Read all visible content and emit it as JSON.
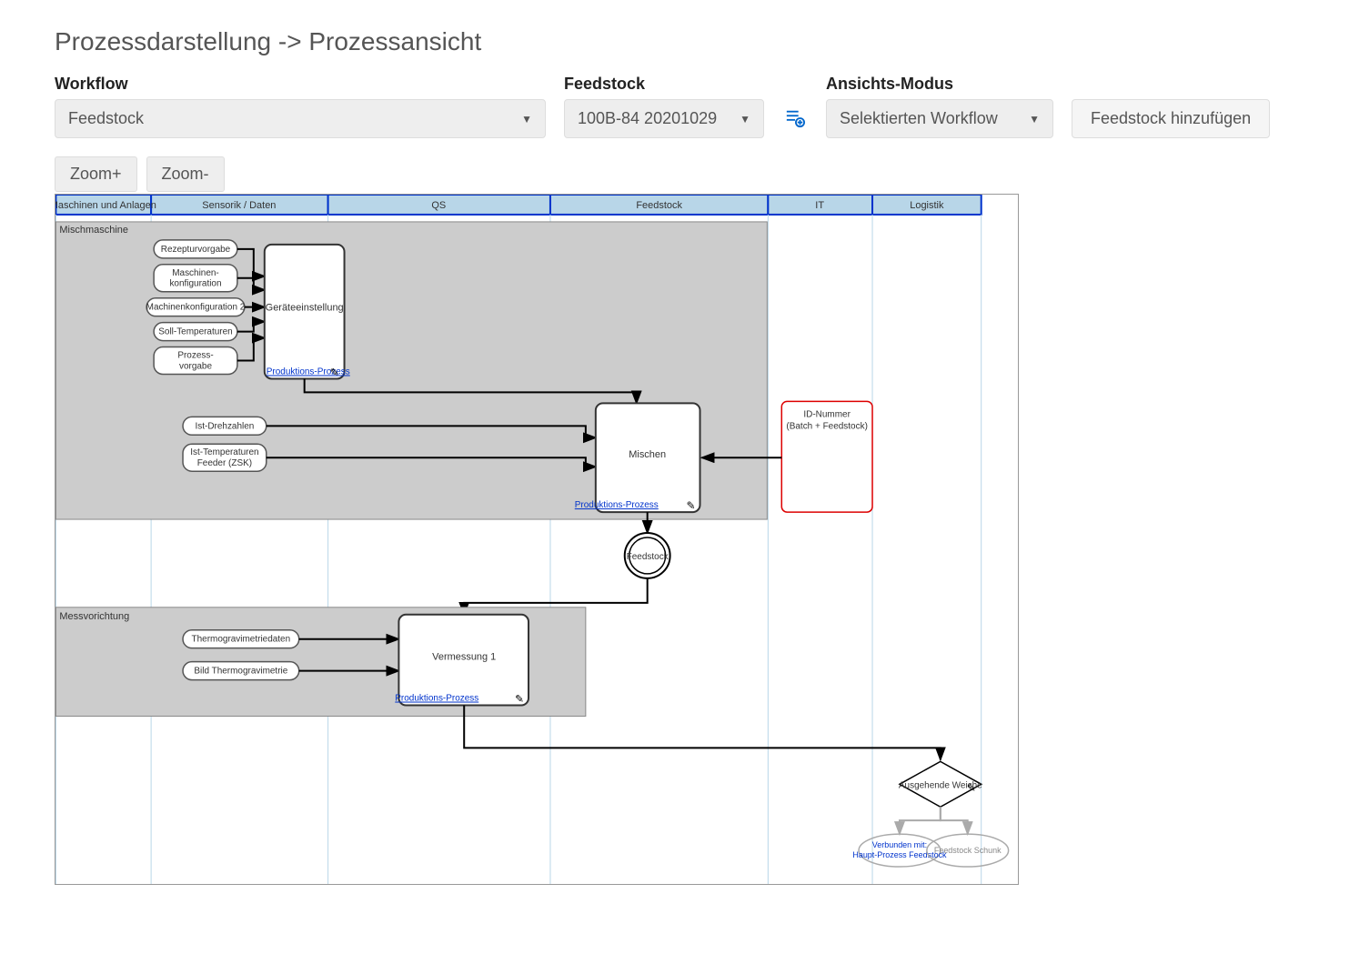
{
  "page_title": "Prozessdarstellung -> Prozessansicht",
  "controls": {
    "workflow_label": "Workflow",
    "workflow_value": "Feedstock",
    "feedstock_label": "Feedstock",
    "feedstock_value": "100B-84 20201029",
    "viewmode_label": "Ansichts-Modus",
    "viewmode_value": "Selektierten Workflow",
    "add_feedstock_label": "Feedstock hinzufügen"
  },
  "zoom": {
    "in": "Zoom+",
    "out": "Zoom-"
  },
  "lanes": {
    "l1": "Maschinen und Anlagen",
    "l2": "Sensorik / Daten",
    "l3": "QS",
    "l4": "Feedstock",
    "l5": "IT",
    "l6": "Logistik"
  },
  "pools": {
    "p1": "Mischmaschine",
    "p2": "Messvorichtung"
  },
  "inputs": {
    "i1": "Rezepturvorgabe",
    "i2a": "Maschinen-",
    "i2b": "konfiguration",
    "i3": "Machinenkonfiguration 2",
    "i4": "Soll-Temperaturen",
    "i5a": "Prozess-",
    "i5b": "vorgabe",
    "i6": "Ist-Drehzahlen",
    "i7a": "Ist-Temperaturen",
    "i7b": "Feeder (ZSK)",
    "i8": "Thermogravimetriedaten",
    "i9": "Bild Thermogravimetrie"
  },
  "processes": {
    "p1": "Geräteeinstellung",
    "p2": "Mischen",
    "p3": "Vermessung 1",
    "link": "Produktions-Prozess"
  },
  "idbox": {
    "l1": "ID-Nummer",
    "l2": "(Batch + Feedstock)"
  },
  "feedstock_circle": "Feedstock",
  "gateway_label": "Ausgehende Weiche",
  "end1": "Verbunden mit:",
  "end1b": "Haupt-Prozess Feedstock",
  "end2": "Feedstock Schunk"
}
